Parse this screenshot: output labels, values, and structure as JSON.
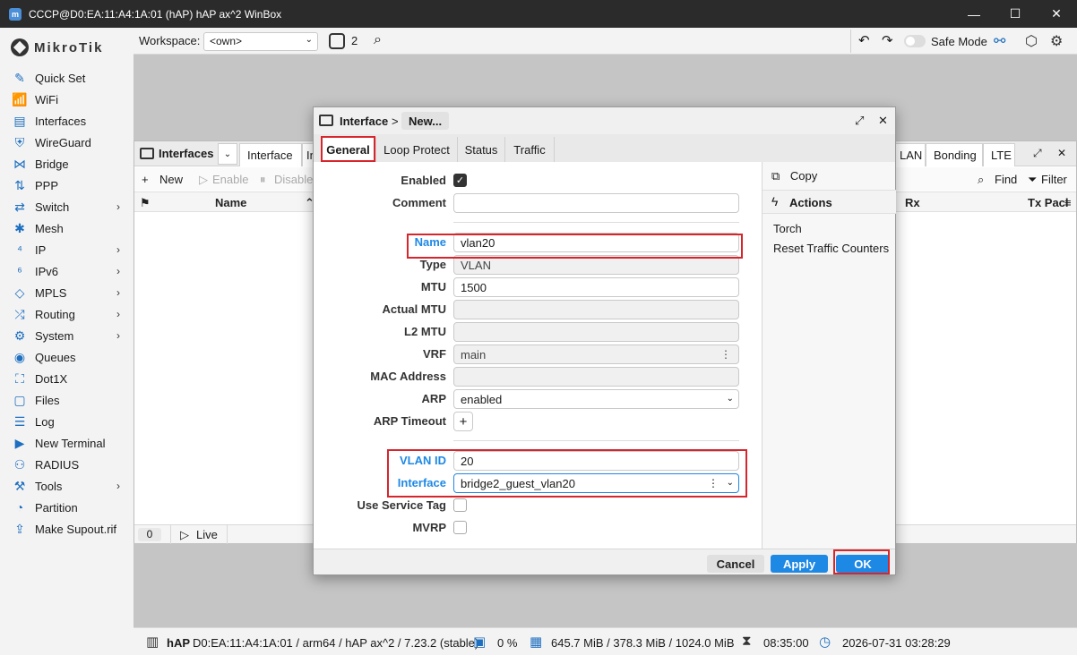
{
  "window": {
    "title": "CCCP@D0:EA:11:A4:1A:01 (hAP) hAP ax^2 WinBox",
    "minimize": "—",
    "maximize": "☐",
    "close": "✕"
  },
  "brand": {
    "logo_text": "MikroTik"
  },
  "sidebar": {
    "items": [
      {
        "label": "Quick Set",
        "icon": "✎",
        "chev": ""
      },
      {
        "label": "WiFi",
        "icon": "📶",
        "chev": ""
      },
      {
        "label": "Interfaces",
        "icon": "▤",
        "chev": ""
      },
      {
        "label": "WireGuard",
        "icon": "⛨",
        "chev": ""
      },
      {
        "label": "Bridge",
        "icon": "⋈",
        "chev": ""
      },
      {
        "label": "PPP",
        "icon": "⇅",
        "chev": ""
      },
      {
        "label": "Switch",
        "icon": "⇄",
        "chev": "›"
      },
      {
        "label": "Mesh",
        "icon": "✱",
        "chev": ""
      },
      {
        "label": "IP",
        "icon": "⁴",
        "chev": "›"
      },
      {
        "label": "IPv6",
        "icon": "⁶",
        "chev": "›"
      },
      {
        "label": "MPLS",
        "icon": "◇",
        "chev": "›"
      },
      {
        "label": "Routing",
        "icon": "⤮",
        "chev": "›"
      },
      {
        "label": "System",
        "icon": "⚙",
        "chev": "›"
      },
      {
        "label": "Queues",
        "icon": "◉",
        "chev": ""
      },
      {
        "label": "Dot1X",
        "icon": "⛶",
        "chev": ""
      },
      {
        "label": "Files",
        "icon": "▢",
        "chev": ""
      },
      {
        "label": "Log",
        "icon": "☰",
        "chev": ""
      },
      {
        "label": "New Terminal",
        "icon": "▶",
        "chev": ""
      },
      {
        "label": "RADIUS",
        "icon": "⚇",
        "chev": ""
      },
      {
        "label": "Tools",
        "icon": "⚒",
        "chev": "›"
      },
      {
        "label": "Partition",
        "icon": "◔",
        "chev": ""
      },
      {
        "label": "Make Supout.rif",
        "icon": "⇪",
        "chev": ""
      }
    ]
  },
  "toolbar": {
    "workspace_label": "Workspace:",
    "workspace_value": "<own>",
    "window_count": "2",
    "safe_mode_label": "Safe Mode"
  },
  "interfaces_window": {
    "title": "Interfaces",
    "tabs_left": [
      "Interface",
      "In"
    ],
    "tabs_right": [
      "LAN",
      "Bonding",
      "LTE"
    ],
    "actions": {
      "new": "New",
      "enable": "Enable",
      "disable": "Disable",
      "find": "Find",
      "filter": "Filter"
    },
    "columns": {
      "name": "Name",
      "rx": "Rx",
      "txp": "Tx Pacl"
    },
    "footer": {
      "count": "0",
      "live": "Live"
    }
  },
  "dialog": {
    "breadcrumb": "Interface",
    "separator": ">",
    "new_label": "New...",
    "tabs": [
      "General",
      "Loop Protect",
      "Status",
      "Traffic"
    ],
    "fields": {
      "enabled_label": "Enabled",
      "comment_label": "Comment",
      "comment_value": "",
      "name_label": "Name",
      "name_value": "vlan20",
      "type_label": "Type",
      "type_value": "VLAN",
      "mtu_label": "MTU",
      "mtu_value": "1500",
      "actual_mtu_label": "Actual MTU",
      "l2mtu_label": "L2 MTU",
      "vrf_label": "VRF",
      "vrf_value": "main",
      "mac_label": "MAC Address",
      "arp_label": "ARP",
      "arp_value": "enabled",
      "arp_timeout_label": "ARP Timeout",
      "vlan_id_label": "VLAN ID",
      "vlan_id_value": "20",
      "interface_label": "Interface",
      "interface_value": "bridge2_guest_vlan20",
      "use_service_tag_label": "Use Service Tag",
      "mvrp_label": "MVRP"
    },
    "side": {
      "copy": "Copy",
      "actions_heading": "Actions",
      "torch": "Torch",
      "reset_counters": "Reset Traffic Counters"
    },
    "buttons": {
      "cancel": "Cancel",
      "apply": "Apply",
      "ok": "OK"
    }
  },
  "statusbar": {
    "device": "hAP",
    "info": "D0:EA:11:A4:1A:01 / arm64 / hAP ax^2 / 7.23.2 (stable)",
    "cpu": "0 %",
    "memory": "645.7 MiB / 378.3 MiB / 1024.0 MiB",
    "uptime": "08:35:00",
    "datetime": "2026-07-31 03:28:29"
  },
  "colors": {
    "accent": "#1e88e5",
    "highlight": "#d6262c",
    "titlebar": "#2b2b2b"
  }
}
